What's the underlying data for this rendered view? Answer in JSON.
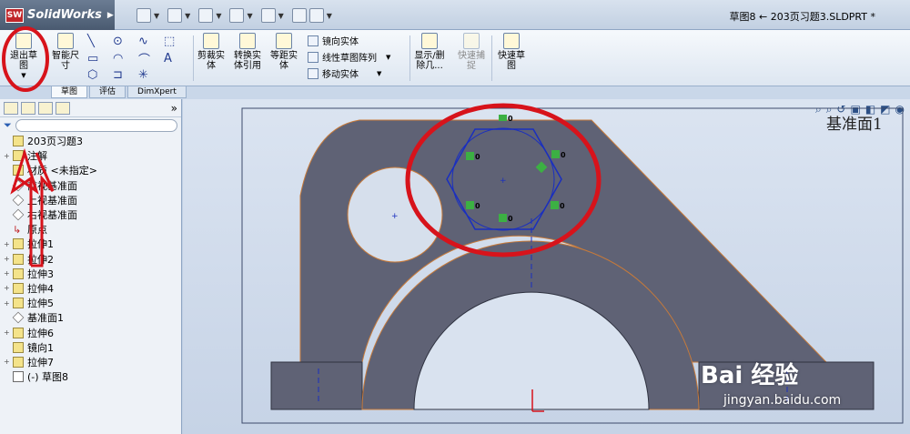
{
  "app": {
    "name": "SolidWorks",
    "doc_title": "草图8 ← 203页习题3.SLDPRT *"
  },
  "ribbon": {
    "exit_sketch": "退出草图",
    "smart_dimension": "智能尺寸",
    "trim_entities": "剪裁实体",
    "convert_entities": "转换实体引用",
    "offset_entities": "等距实体",
    "mirror_entities": "镜向实体",
    "linear_pattern": "线性草图阵列",
    "move_entities": "移动实体",
    "display_delete": "显示/删除几...",
    "quick_snaps": "快速捕捉",
    "rapid_sketch": "快速草图"
  },
  "tabs": [
    "草图",
    "评估",
    "DimXpert"
  ],
  "tree": {
    "root": "203页习题3",
    "items": [
      {
        "label": "注解",
        "type": "annot",
        "exp": "+"
      },
      {
        "label": "材质 <未指定>",
        "type": "mat",
        "exp": ""
      },
      {
        "label": "前视基准面",
        "type": "plane",
        "exp": ""
      },
      {
        "label": "上视基准面",
        "type": "plane",
        "exp": ""
      },
      {
        "label": "右视基准面",
        "type": "plane",
        "exp": ""
      },
      {
        "label": "原点",
        "type": "origin",
        "exp": ""
      },
      {
        "label": "拉伸1",
        "type": "feat",
        "exp": "+"
      },
      {
        "label": "拉伸2",
        "type": "feat",
        "exp": "+"
      },
      {
        "label": "拉伸3",
        "type": "feat",
        "exp": "+"
      },
      {
        "label": "拉伸4",
        "type": "feat",
        "exp": "+"
      },
      {
        "label": "拉伸5",
        "type": "feat",
        "exp": "+"
      },
      {
        "label": "基准面1",
        "type": "plane",
        "exp": ""
      },
      {
        "label": "拉伸6",
        "type": "feat",
        "exp": "+"
      },
      {
        "label": "镜向1",
        "type": "feat",
        "exp": ""
      },
      {
        "label": "拉伸7",
        "type": "feat",
        "exp": "+"
      },
      {
        "label": "(-) 草图8",
        "type": "sketch",
        "exp": ""
      }
    ]
  },
  "graphics": {
    "plane_label": "基准面1",
    "relation_tags": [
      "0",
      "0",
      "0",
      "0",
      "0",
      "0"
    ]
  },
  "watermark": {
    "logo": "Bai 经验",
    "url": "jingyan.baidu.com"
  },
  "colors": {
    "part_face": "#5f6275",
    "sketch_blue": "#1a2fbf",
    "annotation_red": "#d7131b",
    "edge_orange": "#c77a3a"
  }
}
